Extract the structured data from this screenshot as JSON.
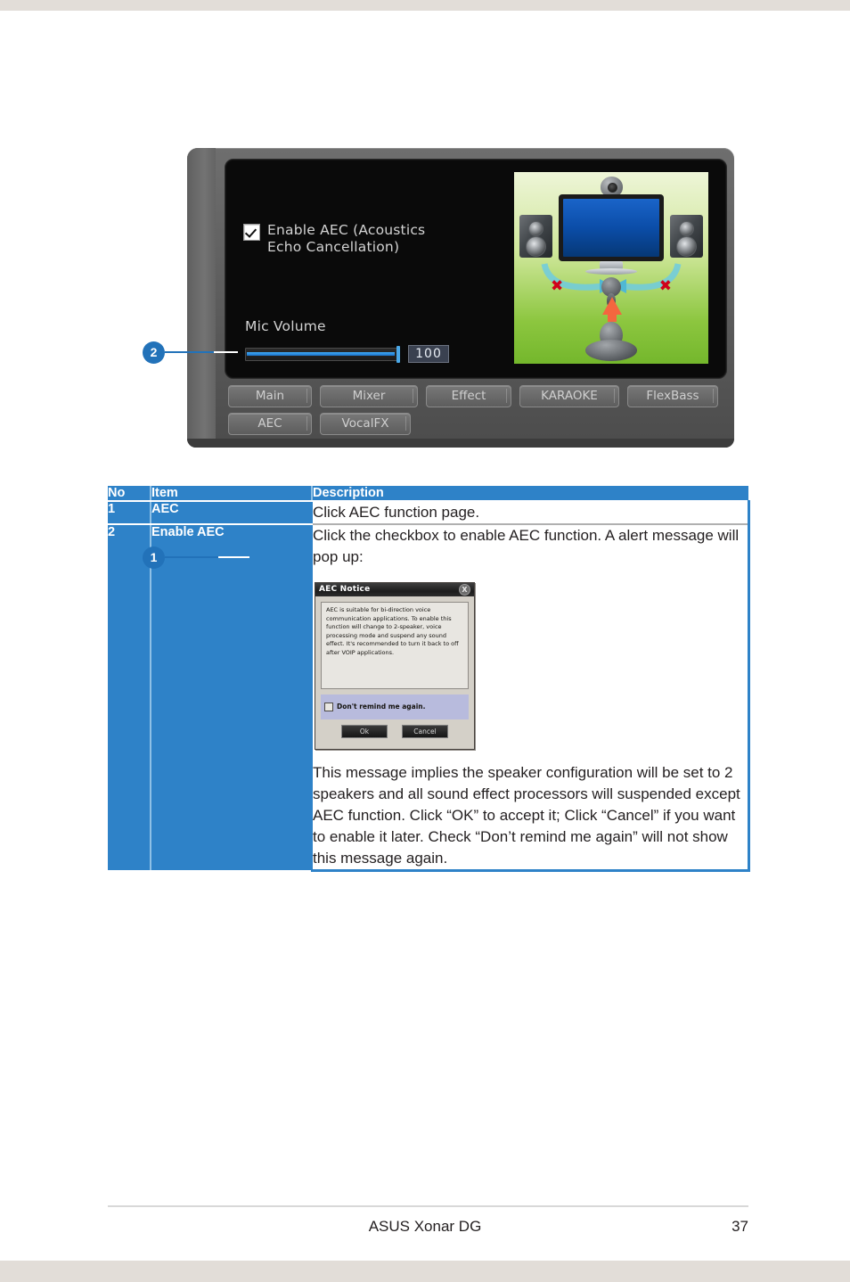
{
  "page": {
    "footer_title": "ASUS Xonar DG",
    "page_number": "37"
  },
  "figure": {
    "callouts": [
      {
        "id": "1",
        "label": "1"
      },
      {
        "id": "2",
        "label": "2"
      }
    ],
    "panel": {
      "enable_aec_label": "Enable AEC (Acoustics\nEcho Cancellation)",
      "enable_aec_checked": true,
      "mic_volume_label": "Mic Volume",
      "mic_volume_value": "100",
      "mic_volume_percent": 97,
      "tabs_row1": [
        "Main",
        "Mixer",
        "Effect",
        "KARAOKE",
        "FlexBass"
      ],
      "tabs_row2": [
        "AEC",
        "VocalFX"
      ],
      "illustration_name": "aec-speaker-mic-diagram"
    }
  },
  "table": {
    "headers": [
      "No",
      "Item",
      "Description"
    ],
    "rows": [
      {
        "no": "1",
        "item": "AEC",
        "description": "Click AEC function page."
      },
      {
        "no": "2",
        "item": "Enable AEC",
        "description_top": "Click the checkbox to enable AEC function. A alert message will pop up:",
        "description_bottom": "This message implies the speaker configuration will be set to 2 speakers and all sound effect processors will suspended except AEC function. Click “OK” to accept it; Click “Cancel” if you want to enable it later. Check “Don’t remind me again” will not show this message again."
      }
    ]
  },
  "dialog": {
    "title": "AEC Notice",
    "close_label": "X",
    "body": "AEC is suitable for bi-direction voice communication applications. To enable this function will change to 2-speaker, voice processing mode and suspend any sound effect. It's recommended to turn it back to off after VOIP applications.",
    "remind_label": "Don't remind me again.",
    "ok_label": "Ok",
    "cancel_label": "Cancel"
  },
  "colors": {
    "table_blue": "#2e82c8",
    "callout_blue": "#2272b9",
    "page_band": "#e2ddd8"
  }
}
